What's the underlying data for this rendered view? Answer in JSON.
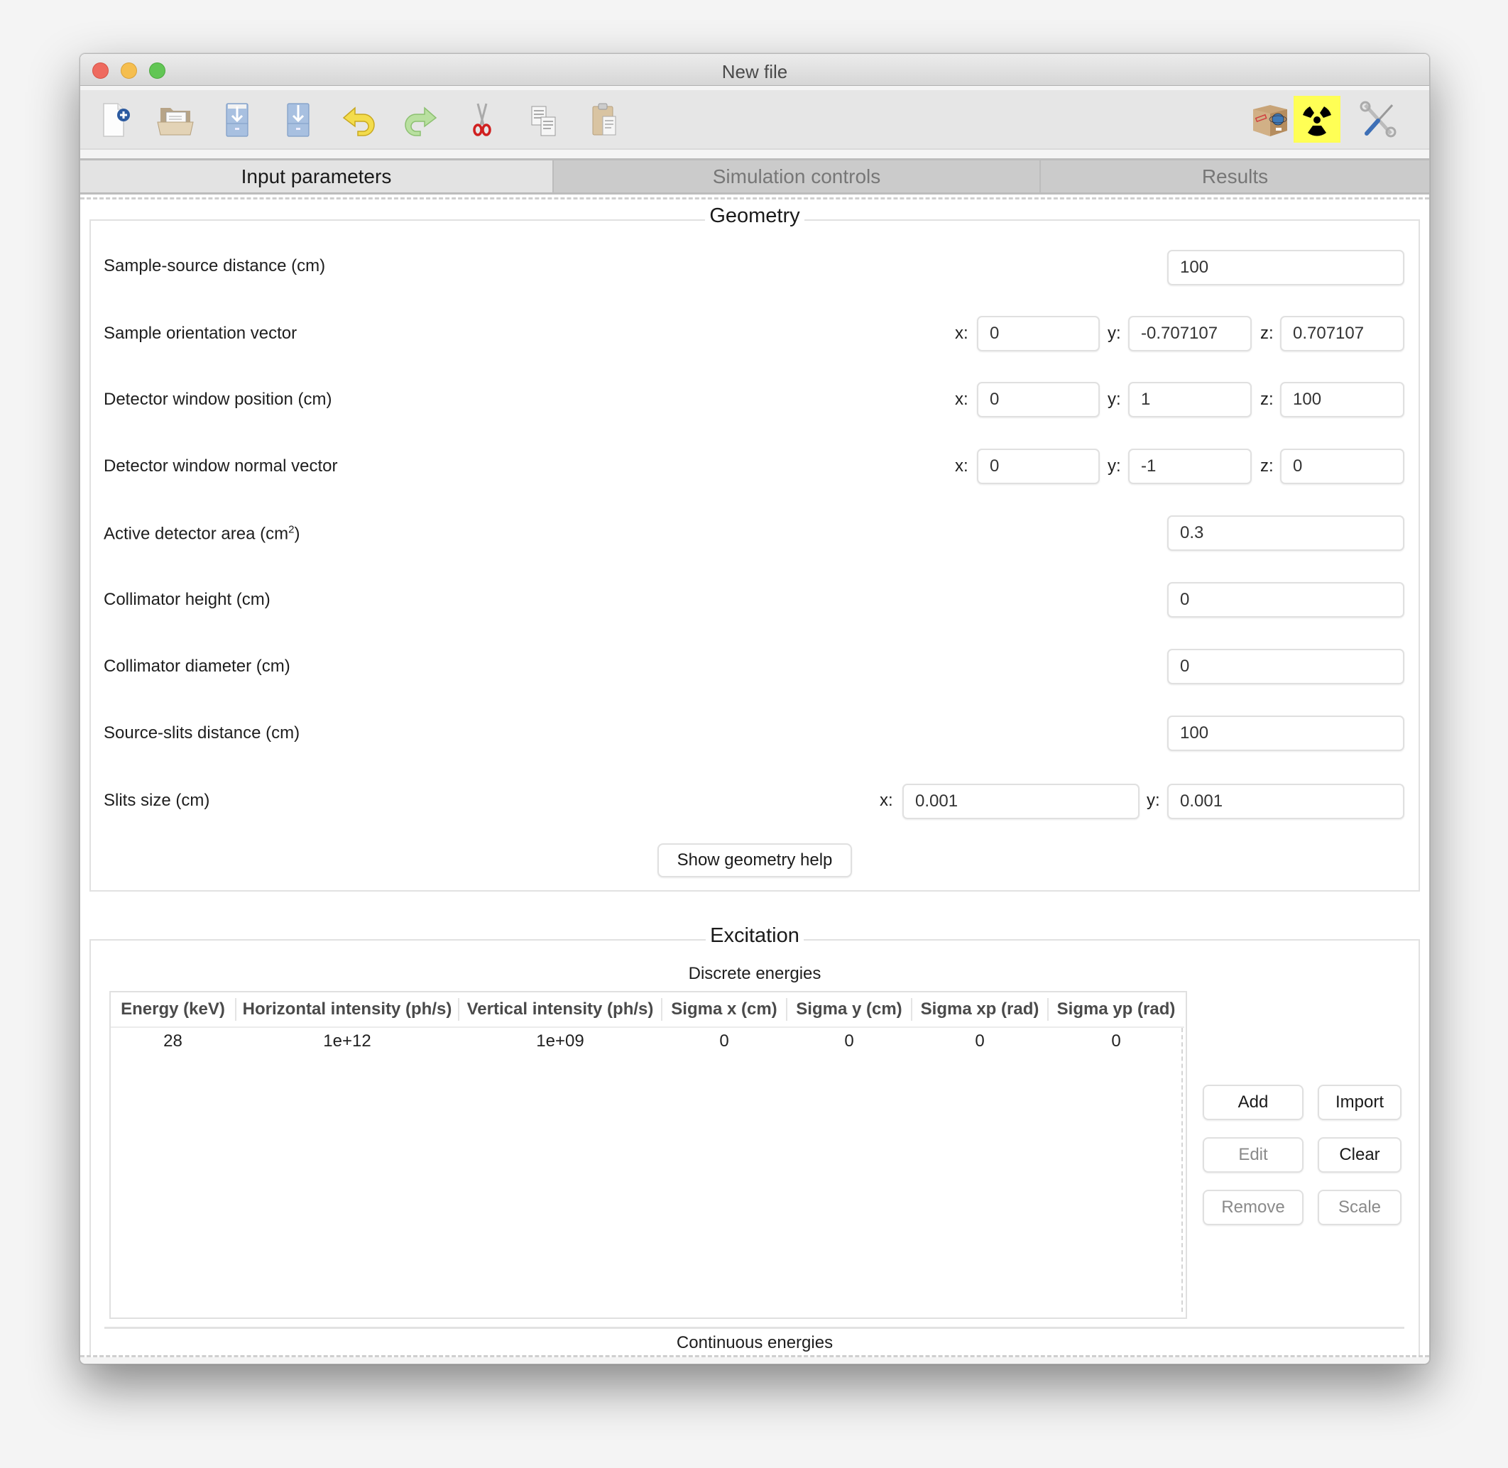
{
  "window": {
    "title": "New file"
  },
  "toolbar": {
    "left_icons": [
      {
        "name": "new-file-icon",
        "label": "New"
      },
      {
        "name": "open-folder-icon",
        "label": "Open"
      },
      {
        "name": "save-icon",
        "label": "Save"
      },
      {
        "name": "save-as-icon",
        "label": "Save as"
      },
      {
        "name": "undo-icon",
        "label": "Undo"
      },
      {
        "name": "redo-icon",
        "label": "Redo"
      },
      {
        "name": "cut-icon",
        "label": "Cut"
      },
      {
        "name": "copy-icon",
        "label": "Copy"
      },
      {
        "name": "paste-icon",
        "label": "Paste"
      }
    ],
    "right_icons": [
      {
        "name": "package-icon",
        "label": "Package"
      },
      {
        "name": "radiation-icon",
        "label": "Radiation",
        "highlight": "#ffff55"
      },
      {
        "name": "tools-icon",
        "label": "Preferences"
      }
    ]
  },
  "tabs": [
    {
      "label": "Input parameters",
      "active": true
    },
    {
      "label": "Simulation controls",
      "active": false
    },
    {
      "label": "Results",
      "active": false
    }
  ],
  "geometry": {
    "title": "Geometry",
    "sample_source_distance": {
      "label": "Sample-source distance (cm)",
      "value": "100"
    },
    "sample_orientation": {
      "label": "Sample orientation vector",
      "x": "0",
      "y": "-0.707107",
      "z": "0.707107"
    },
    "detector_position": {
      "label": "Detector window position (cm)",
      "x": "0",
      "y": "1",
      "z": "100"
    },
    "detector_normal": {
      "label": "Detector window normal vector",
      "x": "0",
      "y": "-1",
      "z": "0"
    },
    "active_area": {
      "label_main": "Active detector area (cm",
      "label_sup": "2",
      "label_end": ")",
      "value": "0.3"
    },
    "collimator_height": {
      "label": "Collimator height (cm)",
      "value": "0"
    },
    "collimator_diameter": {
      "label": "Collimator diameter (cm)",
      "value": "0"
    },
    "source_slits_distance": {
      "label": "Source-slits distance (cm)",
      "value": "100"
    },
    "slits_size": {
      "label": "Slits size (cm)",
      "x": "0.001",
      "y": "0.001"
    },
    "axis_labels": {
      "x": "x:",
      "y": "y:",
      "z": "z:"
    },
    "help_button": "Show geometry help"
  },
  "excitation": {
    "title": "Excitation",
    "discrete_title": "Discrete energies",
    "columns": [
      "Energy (keV)",
      "Horizontal intensity (ph/s)",
      "Vertical intensity (ph/s)",
      "Sigma x (cm)",
      "Sigma y (cm)",
      "Sigma xp (rad)",
      "Sigma yp (rad)"
    ],
    "rows": [
      [
        "28",
        "1e+12",
        "1e+09",
        "0",
        "0",
        "0",
        "0"
      ]
    ],
    "buttons": {
      "add": {
        "label": "Add",
        "enabled": true
      },
      "import": {
        "label": "Import",
        "enabled": true
      },
      "edit": {
        "label": "Edit",
        "enabled": false
      },
      "clear": {
        "label": "Clear",
        "enabled": true
      },
      "remove": {
        "label": "Remove",
        "enabled": false
      },
      "scale": {
        "label": "Scale",
        "enabled": false
      }
    },
    "continuous_title": "Continuous energies"
  }
}
